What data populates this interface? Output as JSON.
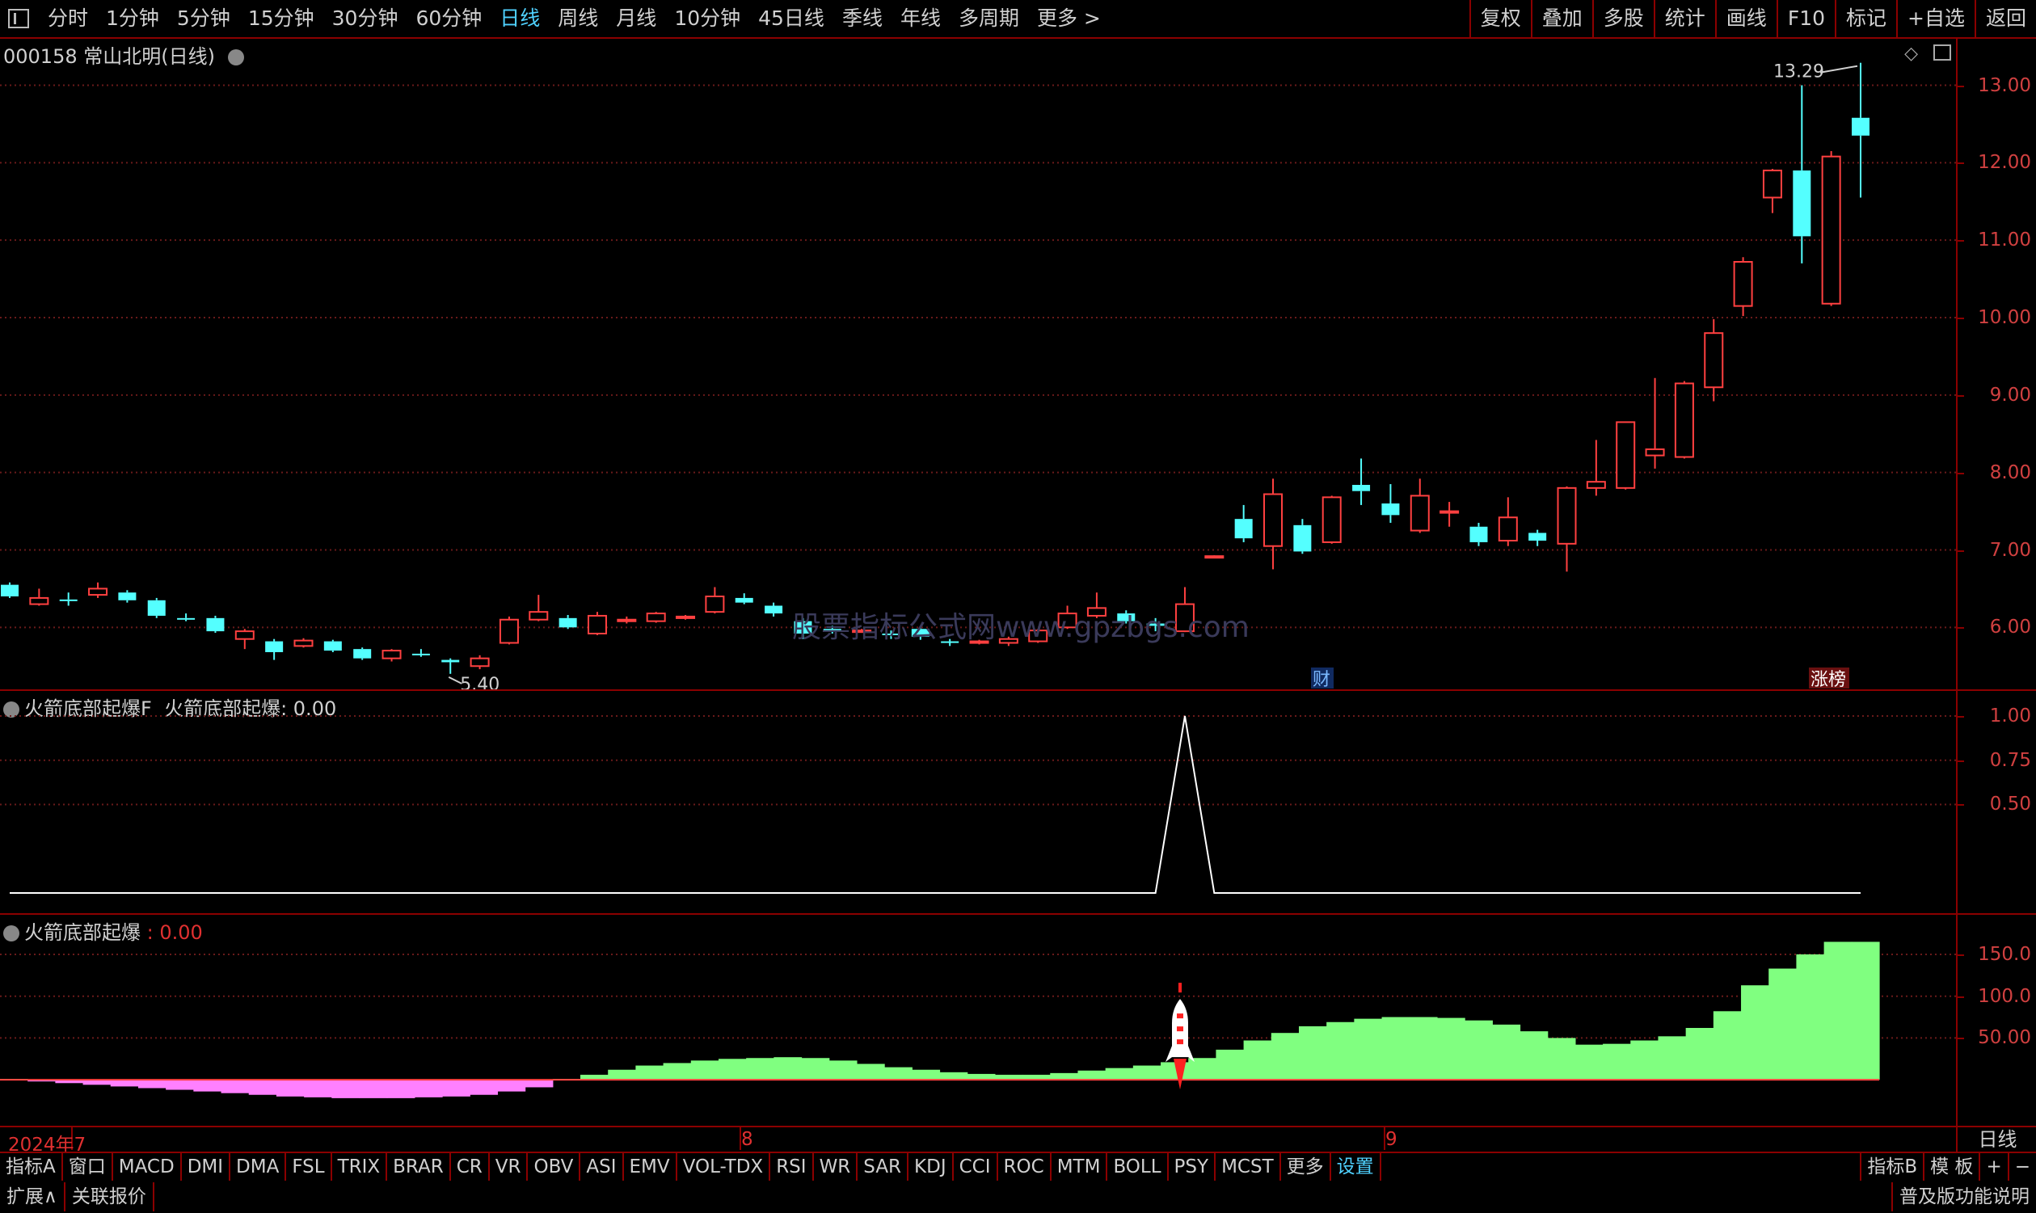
{
  "topbar": {
    "periods": [
      "分时",
      "1分钟",
      "5分钟",
      "15分钟",
      "30分钟",
      "60分钟",
      "日线",
      "周线",
      "月线",
      "10分钟",
      "45日线",
      "季线",
      "年线",
      "多周期",
      "更多 >"
    ],
    "active_period": "日线",
    "right_buttons": [
      "复权",
      "叠加",
      "多股",
      "统计",
      "画线",
      "F10",
      "标记",
      "+自选",
      "返回"
    ]
  },
  "main_panel": {
    "title": "000158 常山北明(日线)",
    "high_label": "13.29",
    "low_label": "5.40",
    "marker_cai": "财",
    "marker_zhangbang": "涨榜",
    "watermark": "股票指标公式网www.gpzbgs.com",
    "y_ticks": [
      "13.00",
      "12.00",
      "11.00",
      "10.00",
      "9.00",
      "8.00",
      "7.00",
      "6.00"
    ]
  },
  "indicator1": {
    "title_name": "火箭底部起爆F",
    "title_value": "火箭底部起爆: 0.00",
    "y_ticks": [
      "1.00",
      "0.75",
      "0.50"
    ]
  },
  "indicator2": {
    "title_name": "火箭底部起爆",
    "title_value": ": 0.00",
    "y_ticks": [
      "150.0",
      "100.0",
      "50.00"
    ]
  },
  "date_axis": {
    "labels": [
      "2024年7",
      "8",
      "9"
    ],
    "period_label": "日线"
  },
  "bottombar": {
    "tabs": [
      "指标A",
      "窗口",
      "MACD",
      "DMI",
      "DMA",
      "FSL",
      "TRIX",
      "BRAR",
      "CR",
      "VR",
      "OBV",
      "ASI",
      "EMV",
      "VOL-TDX",
      "RSI",
      "WR",
      "SAR",
      "KDJ",
      "CCI",
      "ROC",
      "MTM",
      "BOLL",
      "PSY",
      "MCST",
      "更多",
      "设置"
    ],
    "active_tab": "设置",
    "right_tabs": [
      "指标B",
      "模 板",
      "+",
      "−"
    ]
  },
  "statusbar": {
    "left": [
      "扩展∧",
      "关联报价"
    ],
    "right": "普及版功能说明"
  },
  "colors": {
    "up": "#ff4040",
    "down": "#54ffff",
    "indicator_up": "#80ff80",
    "indicator_down": "#ff80ff",
    "grid": "#6a1a1a",
    "frame": "#8b0000"
  },
  "chart_data": [
    {
      "type": "candlestick",
      "title": "000158 常山北明(日线)",
      "ylim": [
        5.2,
        13.6
      ],
      "candles": [
        {
          "o": 6.55,
          "c": 6.4,
          "h": 6.58,
          "l": 6.38
        },
        {
          "o": 6.3,
          "c": 6.38,
          "h": 6.5,
          "l": 6.28
        },
        {
          "o": 6.36,
          "c": 6.35,
          "h": 6.45,
          "l": 6.28
        },
        {
          "o": 6.42,
          "c": 6.5,
          "h": 6.58,
          "l": 6.38
        },
        {
          "o": 6.45,
          "c": 6.35,
          "h": 6.48,
          "l": 6.32
        },
        {
          "o": 6.35,
          "c": 6.15,
          "h": 6.38,
          "l": 6.12
        },
        {
          "o": 6.12,
          "c": 6.1,
          "h": 6.18,
          "l": 6.08
        },
        {
          "o": 6.12,
          "c": 5.95,
          "h": 6.15,
          "l": 5.93
        },
        {
          "o": 5.85,
          "c": 5.95,
          "h": 5.98,
          "l": 5.72
        },
        {
          "o": 5.82,
          "c": 5.68,
          "h": 5.85,
          "l": 5.58
        },
        {
          "o": 5.76,
          "c": 5.83,
          "h": 5.86,
          "l": 5.74
        },
        {
          "o": 5.82,
          "c": 5.7,
          "h": 5.84,
          "l": 5.68
        },
        {
          "o": 5.72,
          "c": 5.6,
          "h": 5.74,
          "l": 5.58
        },
        {
          "o": 5.6,
          "c": 5.7,
          "h": 5.72,
          "l": 5.56
        },
        {
          "o": 5.66,
          "c": 5.65,
          "h": 5.72,
          "l": 5.62
        },
        {
          "o": 5.58,
          "c": 5.55,
          "h": 5.6,
          "l": 5.4
        },
        {
          "o": 5.5,
          "c": 5.6,
          "h": 5.64,
          "l": 5.46
        },
        {
          "o": 5.8,
          "c": 6.1,
          "h": 6.14,
          "l": 5.78
        },
        {
          "o": 6.1,
          "c": 6.2,
          "h": 6.42,
          "l": 6.08
        },
        {
          "o": 6.12,
          "c": 6.0,
          "h": 6.16,
          "l": 5.98
        },
        {
          "o": 5.92,
          "c": 6.15,
          "h": 6.2,
          "l": 5.9
        },
        {
          "o": 6.08,
          "c": 6.1,
          "h": 6.14,
          "l": 6.05
        },
        {
          "o": 6.08,
          "c": 6.18,
          "h": 6.2,
          "l": 6.06
        },
        {
          "o": 6.12,
          "c": 6.14,
          "h": 6.16,
          "l": 6.1
        },
        {
          "o": 6.2,
          "c": 6.4,
          "h": 6.52,
          "l": 6.18
        },
        {
          "o": 6.38,
          "c": 6.32,
          "h": 6.44,
          "l": 6.3
        },
        {
          "o": 6.28,
          "c": 6.18,
          "h": 6.32,
          "l": 6.14
        },
        {
          "o": 6.08,
          "c": 5.92,
          "h": 6.12,
          "l": 5.85
        },
        {
          "o": 5.98,
          "c": 5.96,
          "h": 6.02,
          "l": 5.92
        },
        {
          "o": 5.95,
          "c": 5.96,
          "h": 5.98,
          "l": 5.93
        },
        {
          "o": 5.92,
          "c": 5.9,
          "h": 5.96,
          "l": 5.85
        },
        {
          "o": 5.98,
          "c": 5.88,
          "h": 6.0,
          "l": 5.84
        },
        {
          "o": 5.82,
          "c": 5.8,
          "h": 5.85,
          "l": 5.76
        },
        {
          "o": 5.8,
          "c": 5.82,
          "h": 5.84,
          "l": 5.78
        },
        {
          "o": 5.8,
          "c": 5.85,
          "h": 5.88,
          "l": 5.76
        },
        {
          "o": 5.82,
          "c": 5.96,
          "h": 5.98,
          "l": 5.8
        },
        {
          "o": 6.0,
          "c": 6.18,
          "h": 6.28,
          "l": 5.98
        },
        {
          "o": 6.15,
          "c": 6.25,
          "h": 6.45,
          "l": 6.12
        },
        {
          "o": 6.18,
          "c": 6.08,
          "h": 6.22,
          "l": 6.05
        },
        {
          "o": 6.05,
          "c": 6.02,
          "h": 6.12,
          "l": 5.95
        },
        {
          "o": 5.95,
          "c": 6.3,
          "h": 6.52,
          "l": 5.94
        },
        {
          "o": 6.92,
          "c": 6.92,
          "h": 6.93,
          "l": 6.91
        },
        {
          "o": 7.4,
          "c": 7.15,
          "h": 7.58,
          "l": 7.1
        },
        {
          "o": 7.05,
          "c": 7.72,
          "h": 7.92,
          "l": 6.75
        },
        {
          "o": 7.32,
          "c": 6.98,
          "h": 7.4,
          "l": 6.95
        },
        {
          "o": 7.1,
          "c": 7.68,
          "h": 7.7,
          "l": 7.08
        },
        {
          "o": 7.84,
          "c": 7.76,
          "h": 8.18,
          "l": 7.58
        },
        {
          "o": 7.6,
          "c": 7.45,
          "h": 7.85,
          "l": 7.35
        },
        {
          "o": 7.25,
          "c": 7.7,
          "h": 7.92,
          "l": 7.22
        },
        {
          "o": 7.48,
          "c": 7.5,
          "h": 7.62,
          "l": 7.3
        },
        {
          "o": 7.3,
          "c": 7.1,
          "h": 7.35,
          "l": 7.05
        },
        {
          "o": 7.12,
          "c": 7.42,
          "h": 7.68,
          "l": 7.05
        },
        {
          "o": 7.22,
          "c": 7.12,
          "h": 7.26,
          "l": 7.05
        },
        {
          "o": 7.08,
          "c": 7.8,
          "h": 7.82,
          "l": 6.72
        },
        {
          "o": 7.8,
          "c": 7.88,
          "h": 8.42,
          "l": 7.7
        },
        {
          "o": 7.8,
          "c": 8.65,
          "h": 8.65,
          "l": 7.78
        },
        {
          "o": 8.22,
          "c": 8.3,
          "h": 9.22,
          "l": 8.05
        },
        {
          "o": 8.2,
          "c": 9.15,
          "h": 9.18,
          "l": 8.18
        },
        {
          "o": 9.1,
          "c": 9.8,
          "h": 9.98,
          "l": 8.92
        },
        {
          "o": 10.15,
          "c": 10.72,
          "h": 10.78,
          "l": 10.02
        },
        {
          "o": 11.55,
          "c": 11.9,
          "h": 11.92,
          "l": 11.35
        },
        {
          "o": 11.9,
          "c": 11.05,
          "h": 13.0,
          "l": 10.7
        },
        {
          "o": 10.18,
          "c": 12.08,
          "h": 12.15,
          "l": 10.15
        },
        {
          "o": 12.58,
          "c": 12.35,
          "h": 13.29,
          "l": 11.55
        }
      ]
    },
    {
      "type": "line",
      "title": "火箭底部起爆F",
      "ylim": [
        0,
        1.05
      ],
      "values": [
        0,
        0,
        0,
        0,
        0,
        0,
        0,
        0,
        0,
        0,
        0,
        0,
        0,
        0,
        0,
        0,
        0,
        0,
        0,
        0,
        0,
        0,
        0,
        0,
        0,
        0,
        0,
        0,
        0,
        0,
        0,
        0,
        0,
        0,
        0,
        0,
        0,
        0,
        0,
        0,
        1,
        0,
        0,
        0,
        0,
        0,
        0,
        0,
        0,
        0,
        0,
        0,
        0,
        0,
        0,
        0,
        0,
        0,
        0,
        0,
        0,
        0,
        0,
        0
      ]
    },
    {
      "type": "bar",
      "title": "火箭底部起爆",
      "ylim": [
        -25,
        178
      ],
      "values": [
        1,
        -2,
        -4,
        -6,
        -8,
        -10,
        -12,
        -14,
        -16,
        -18,
        -20,
        -21,
        -22,
        -22,
        -22,
        -21,
        -20,
        -18,
        -14,
        -9,
        1,
        6,
        12,
        17,
        20,
        23,
        25,
        26,
        27,
        26,
        23,
        19,
        15,
        12,
        9,
        7,
        6,
        6,
        8,
        11,
        14,
        17,
        21,
        26,
        36,
        47,
        56,
        64,
        69,
        73,
        75,
        75,
        74,
        71,
        66,
        58,
        50,
        42,
        43,
        47,
        52,
        62,
        82,
        113,
        133,
        150,
        165,
        165
      ]
    }
  ]
}
